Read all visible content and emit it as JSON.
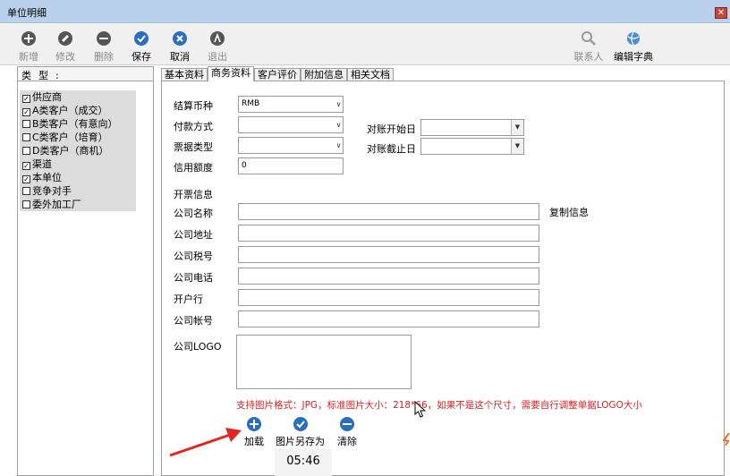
{
  "window": {
    "title": "单位明细",
    "close_symbol": "✕"
  },
  "toolbar": {
    "new": "新增",
    "edit": "修改",
    "delete": "删除",
    "save": "保存",
    "cancel": "取消",
    "exit": "退出",
    "contacts": "联系人",
    "edit_dict": "编辑字典"
  },
  "types": {
    "header": "类型:",
    "items": [
      {
        "label": "供应商",
        "checked": true
      },
      {
        "label": "A类客户（成交）",
        "checked": true
      },
      {
        "label": "B类客户（有意向）",
        "checked": false
      },
      {
        "label": "C类客户（培育）",
        "checked": false
      },
      {
        "label": "D类客户（商机）",
        "checked": false
      },
      {
        "label": "渠道",
        "checked": true
      },
      {
        "label": "本单位",
        "checked": true
      },
      {
        "label": "竞争对手",
        "checked": false
      },
      {
        "label": "委外加工厂",
        "checked": false
      }
    ]
  },
  "tabs": [
    "基本资料",
    "商务资料",
    "客户评价",
    "附加信息",
    "相关文档"
  ],
  "form": {
    "currency_label": "结算币种",
    "currency_value": "RMB",
    "payment_label": "付款方式",
    "payment_value": "",
    "invoice_type_label": "票据类型",
    "invoice_type_value": "",
    "credit_label": "信用额度",
    "credit_value": "0",
    "recon_start_label": "对账开始日",
    "recon_start_value": "",
    "recon_end_label": "对账截止日",
    "recon_end_value": "",
    "invoice_info_label": "开票信息",
    "company_name_label": "公司名称",
    "company_name_value": "",
    "copy_info": "复制信息",
    "company_address_label": "公司地址",
    "company_address_value": "",
    "tax_no_label": "公司税号",
    "tax_no_value": "",
    "phone_label": "公司电话",
    "phone_value": "",
    "bank_label": "开户行",
    "bank_value": "",
    "account_label": "公司帐号",
    "account_value": "",
    "logo_label": "公司LOGO",
    "support_text": "支持图片格式：JPG，标准图片大小：218*66，如果不是这个尺寸，需要自行调整单据LOGO大小",
    "load": "加载",
    "save_image_as": "图片另存为",
    "clear": "清除"
  },
  "status": {
    "time": "05:46"
  },
  "colors": {
    "accent_blue": "#2a6ebd",
    "warning_red": "#e02020",
    "arrow_red": "#e52521"
  }
}
